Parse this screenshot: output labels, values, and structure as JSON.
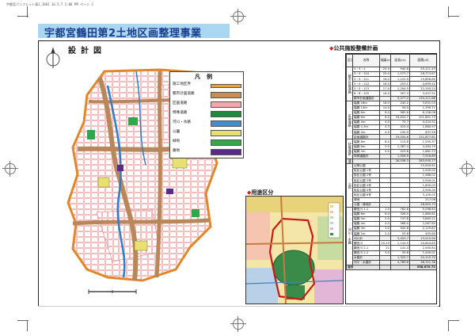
{
  "header_note": "宇都宮パンフレット表2_1001  16.5.7 2:08 PM  ページ 2",
  "title": "宇都宮鶴田第2土地区画整理事業",
  "map_title": "設計図",
  "legend": {
    "title": "凡例",
    "items": [
      {
        "label": "施工地区界",
        "color": "#f0a030"
      },
      {
        "label": "都市計画道路",
        "color": "#c88c55"
      },
      {
        "label": "区画道路",
        "color": "#f2a8a8"
      },
      {
        "label": "特殊道路",
        "color": "#1f8a3a"
      },
      {
        "label": "河川・水路",
        "color": "#3f8ed0"
      },
      {
        "label": "公園",
        "color": "#e8e070"
      },
      {
        "label": "緑地",
        "color": "#2ea84a"
      },
      {
        "label": "墓地",
        "color": "#5a2a8a"
      }
    ]
  },
  "usage_section": "◆用途区分",
  "public_section": "◆公共施設整備計画",
  "table": {
    "headers": [
      "区分",
      "名称",
      "幅員(m)",
      "延長(m)",
      "面積(㎡)"
    ],
    "sections": [
      {
        "category": "都市計画道路",
        "rows": [
          [
            "3・3・1",
            "25.0",
            "940.8",
            "25,111.43"
          ],
          [
            "3・4・104",
            "25.0",
            "1,073.7",
            "28,713.87"
          ],
          [
            "3・4・111",
            "18.0",
            "1,120.9",
            "19,856.80"
          ],
          [
            "3・4・112",
            "16.0",
            "253.1",
            "4,699.52"
          ],
          [
            "3・5・113",
            "17.0",
            "1,294.5",
            "22,195.24"
          ],
          [
            "8・6・105",
            "16.0",
            "397.3",
            "3,457.51"
          ],
          [
            "都市計画道路計",
            "",
            "5,077.2",
            "134,111.88"
          ]
        ]
      },
      {
        "category": "区画道路",
        "rows": [
          [
            "幅員 18m",
            "18.0",
            "240.2",
            "3,831.03"
          ],
          [
            "幅員 14m",
            "14.0",
            "94.0",
            "1,399.71"
          ],
          [
            "幅員 8m",
            "8.0",
            "985.6",
            "8,156.06"
          ],
          [
            "幅員 6m",
            "6.0",
            "16,643.7",
            "101,891.73"
          ],
          [
            "幅員 4m",
            "4.0",
            "72.7",
            "4,124.51"
          ],
          [
            "幅員 4.3m",
            "4.3",
            "415.4",
            "1,860.97"
          ],
          [
            "幅員 4m",
            "4.0",
            "150.9",
            "637.59"
          ],
          [
            "区画道路計",
            "",
            "19,034.6",
            "121,877.81"
          ]
        ]
      },
      {
        "category": "特殊道路",
        "rows": [
          [
            "幅員 8m",
            "8.0",
            "115.8",
            "1,550.37"
          ],
          [
            "幅員 6m",
            "5.0",
            "1,387.4",
            "4,484.79"
          ],
          [
            "幅員 4m",
            "4.0",
            "423.8",
            "1,881.73"
          ],
          [
            "特殊道路計",
            "",
            "1,926.5",
            "7,916.89"
          ]
        ]
      },
      {
        "category": "道路計",
        "rows": [
          [
            "",
            "",
            "26,038.3",
            "263,930.77"
          ]
        ]
      },
      {
        "category": "公園",
        "rows": [
          [
            "近隣公園",
            "",
            "",
            "15,000.61"
          ],
          [
            "街区公園 1号",
            "",
            "",
            "2,500.02"
          ],
          [
            "街区公園 2号",
            "",
            "",
            "1,486.01"
          ],
          [
            "街区公園 3号",
            "",
            "",
            "2,500.01"
          ],
          [
            "街区公園 4号",
            "",
            "",
            "1,600.00"
          ],
          [
            "街区公園 5号",
            "",
            "",
            "2,500.00"
          ],
          [
            "街区公園 6号",
            "",
            "",
            "3,100.02"
          ],
          [
            "緑地",
            "",
            "",
            "217.06"
          ],
          [
            "公園・緑地計",
            "",
            "",
            "28,903.73"
          ]
        ]
      },
      {
        "category": "河川・水路",
        "rows": [
          [
            "鶴田川 1-1",
            "1.0",
            "782.8",
            "5,098.84"
          ],
          [
            "幅員 6m",
            "6.0",
            "326.5",
            "1,860.61"
          ],
          [
            "幅員 5m",
            "5.0",
            "747.8",
            "3,863.21"
          ],
          [
            "幅員 4m",
            "4.0",
            "566.0",
            "2,067.80"
          ],
          [
            "幅員 3m",
            "3.0",
            "942.8",
            "2,129.87"
          ],
          [
            "幅員 2m",
            "2.0",
            "93.8",
            "493.60"
          ],
          [
            "河川計",
            "",
            "3,453.7",
            "13,515.90"
          ],
          [
            "鶴田川",
            "15.25",
            "1,144.5",
            "20,604.85"
          ],
          [
            "鶴田川 2-1",
            "21",
            "141.4",
            "2,505.84"
          ],
          [
            "鶴田川 2-2",
            "3.0",
            "39.8",
            "1,005.01"
          ],
          [
            "水路計",
            "",
            "1,325.7",
            "25,115.70"
          ],
          [
            "河川・水路計",
            "",
            "4,769.6",
            "38,721.36"
          ]
        ]
      }
    ],
    "grand_total": [
      "合計",
      "",
      "",
      "338,670.72"
    ]
  }
}
